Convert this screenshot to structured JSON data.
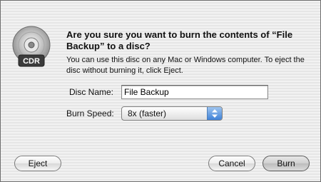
{
  "dialog": {
    "icon": "cdr-disc-icon",
    "icon_text": "CDR",
    "headline": "Are you sure you want to burn the contents of “File Backup” to a disc?",
    "description": "You can use this disc on any Mac or Windows computer. To eject the disc without burning it, click Eject.",
    "disc_name_label": "Disc Name:",
    "disc_name_value": "File Backup",
    "burn_speed_label": "Burn Speed:",
    "burn_speed_value": "8x (faster)",
    "eject_label": "Eject",
    "cancel_label": "Cancel",
    "burn_label": "Burn"
  }
}
